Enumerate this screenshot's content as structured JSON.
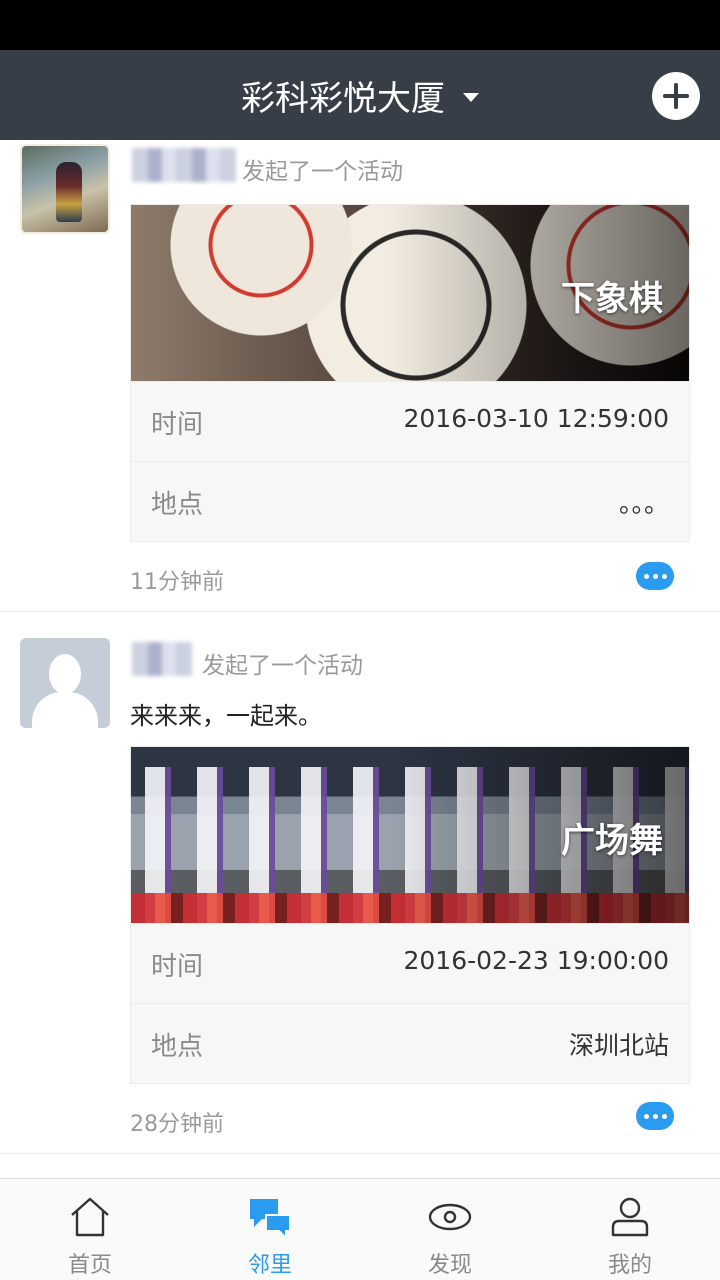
{
  "nav": {
    "title": "彩科彩悦大厦"
  },
  "posts": [
    {
      "action": "发起了一个活动",
      "text": "",
      "banner_title": "下象棋",
      "time_label": "时间",
      "time_value": "2016-03-10 12:59:00",
      "place_label": "地点",
      "place_value": "。。。",
      "time_ago": "11分钟前"
    },
    {
      "action": "发起了一个活动",
      "text": "来来来，一起来。",
      "banner_title": "广场舞",
      "time_label": "时间",
      "time_value": "2016-02-23 19:00:00",
      "place_label": "地点",
      "place_value": "深圳北站",
      "time_ago": "28分钟前"
    }
  ],
  "tabs": [
    {
      "label": "首页",
      "icon": "home-icon",
      "active": false
    },
    {
      "label": "邻里",
      "icon": "chat-icon",
      "active": true
    },
    {
      "label": "发现",
      "icon": "eye-icon",
      "active": false
    },
    {
      "label": "我的",
      "icon": "user-icon",
      "active": false
    }
  ],
  "colors": {
    "nav_bg": "#373e48",
    "accent": "#2a9cf0"
  }
}
